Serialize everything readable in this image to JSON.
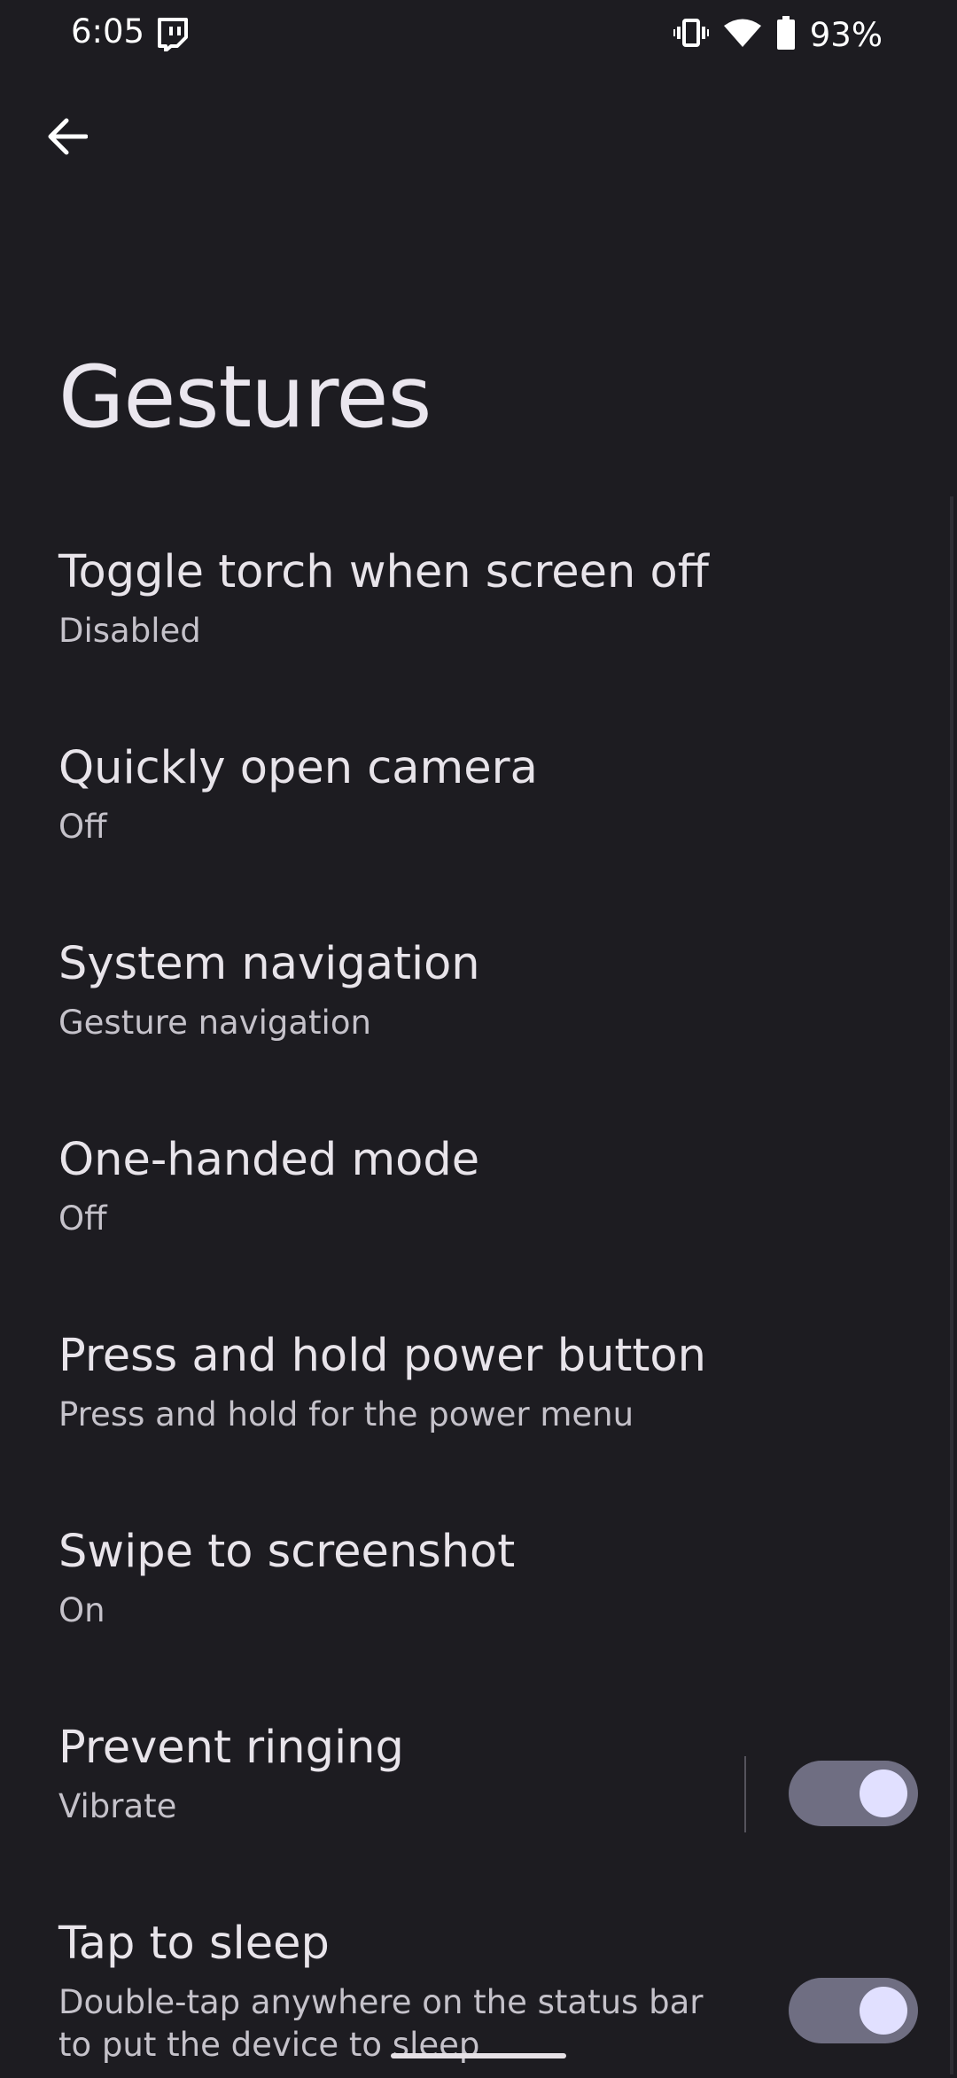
{
  "status_bar": {
    "time": "6:05",
    "battery_percent": "93%",
    "icons": [
      "twitch-notification-icon",
      "vibrate-icon",
      "wifi-icon",
      "battery-icon"
    ]
  },
  "toolbar": {
    "back_icon": "arrow-back-icon"
  },
  "page": {
    "title": "Gestures"
  },
  "settings": [
    {
      "title": "Toggle torch when screen off",
      "summary": "Disabled"
    },
    {
      "title": "Quickly open camera",
      "summary": "Off"
    },
    {
      "title": "System navigation",
      "summary": "Gesture navigation"
    },
    {
      "title": "One-handed mode",
      "summary": "Off"
    },
    {
      "title": "Press and hold power button",
      "summary": "Press and hold for the power menu"
    },
    {
      "title": "Swipe to screenshot",
      "summary": "On"
    },
    {
      "title": "Prevent ringing",
      "summary": "Vibrate",
      "switch": true
    },
    {
      "title": "Tap to sleep",
      "summary": "Double-tap anywhere on the status bar to put the device to sleep",
      "switch": true
    }
  ],
  "colors": {
    "background": "#1d1c21",
    "switch_track_on": "#6f6e82",
    "switch_thumb_on": "#e1e0ff"
  }
}
